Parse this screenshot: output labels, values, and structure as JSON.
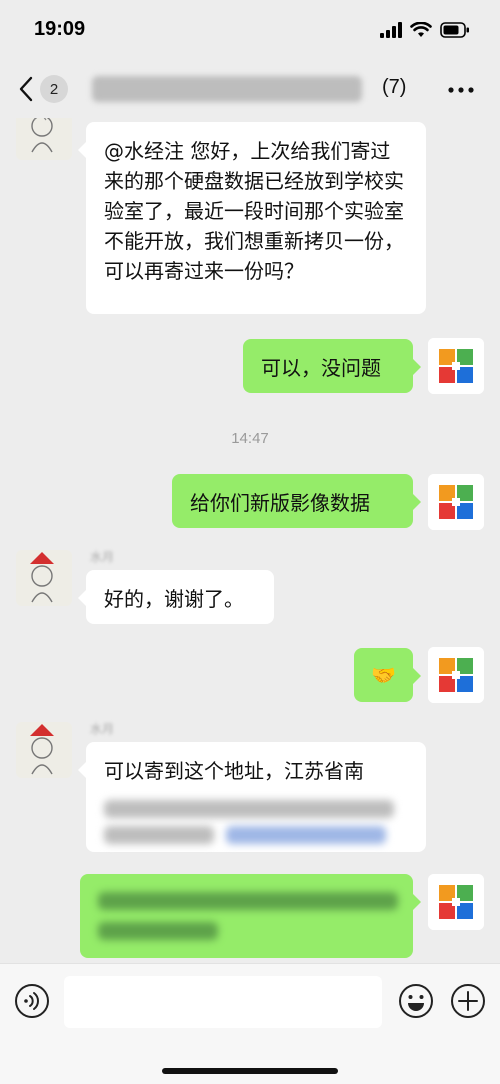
{
  "status_bar": {
    "time": "19:09"
  },
  "nav": {
    "back_badge": "2",
    "member_count": "(7)",
    "more_icon": "more-dots-icon"
  },
  "messages": [
    {
      "side": "left",
      "text": "@水经注 您好，上次给我们寄过来的那个硬盘数据已经放到学校实验室了，最近一段时间那个实验室不能开放，我们想重新拷贝一份，可以再寄过来一份吗？"
    },
    {
      "side": "right",
      "text": "可以，没问题"
    },
    {
      "side": "right",
      "text": "给你们新版影像数据"
    },
    {
      "side": "left",
      "text": "好的，谢谢了。"
    },
    {
      "side": "right",
      "text": "🤝"
    },
    {
      "side": "left",
      "text": "可以寄到这个地址，江苏省南"
    }
  ],
  "timestamp": "14:47",
  "colors": {
    "bubble_me": "#95ec69",
    "bubble_other": "#ffffff",
    "background": "#ededed"
  }
}
